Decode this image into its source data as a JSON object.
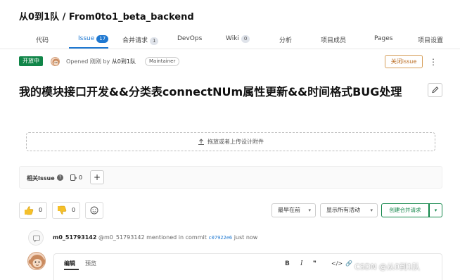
{
  "header": {
    "title": "从0到1队 / From0to1_beta_backend"
  },
  "tabs": [
    {
      "label": "代码"
    },
    {
      "label": "Issue",
      "count": "17"
    },
    {
      "label": "合并请求",
      "count": "1"
    },
    {
      "label": "DevOps"
    },
    {
      "label": "Wiki",
      "count": "0"
    },
    {
      "label": "分析"
    },
    {
      "label": "项目成员"
    },
    {
      "label": "Pages"
    },
    {
      "label": "项目设置"
    }
  ],
  "issue": {
    "status": "开放中",
    "opened_prefix": "Opened 刚刚 by",
    "author": "从0到1队",
    "role": "Maintainer",
    "close_label": "关闭issue",
    "title": "我的模块接口开发&&分类表connectNUm属性更新&&时间格式BUG处理"
  },
  "design": {
    "upload_label": "拖放或者上传设计附件"
  },
  "related": {
    "label": "相关Issue",
    "count": "0",
    "add": "+"
  },
  "reactions": {
    "thumbs_up": "0",
    "thumbs_down": "0"
  },
  "controls": {
    "sort": "最早在前",
    "filter": "显示所有活动",
    "create_mr": "创建合并请求"
  },
  "activity": {
    "author": "m0_51793142",
    "handle": "@m0_51793142",
    "text_mid": "mentioned in commit",
    "commit": "c07922e6",
    "time": "just now"
  },
  "editor": {
    "tab_edit": "编辑",
    "tab_preview": "预览",
    "toolbar_bold": "B",
    "toolbar_italic": "I",
    "toolbar_quote": "❞",
    "toolbar_code": "</>",
    "toolbar_link": "🔗"
  },
  "watermark": "CSDN @从0到1队",
  "colors": {
    "accent": "#1f78d1",
    "open_green": "#108548",
    "close_orange": "#b8691d"
  }
}
